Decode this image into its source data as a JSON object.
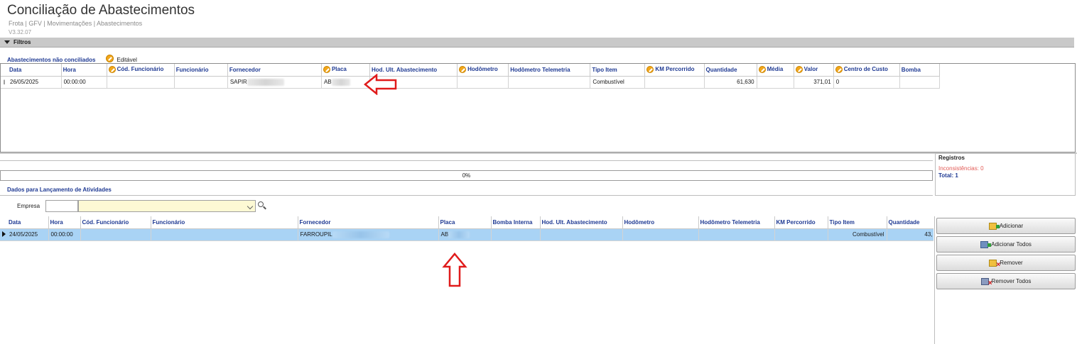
{
  "page": {
    "title": "Conciliação de Abastecimentos",
    "breadcrumb": "Frota | GFV | Movimentações | Abastecimentos",
    "version": "V3.32.07"
  },
  "filters": {
    "label": "Filtros"
  },
  "unconciliated": {
    "title": "Abastecimentos não conciliados",
    "editable_label": "Editável",
    "columns": [
      "Data",
      "Hora",
      "Cód. Funcionário",
      "Funcionário",
      "Fornecedor",
      "Placa",
      "Hod. Ult. Abastecimento",
      "Hodômetro",
      "Hodômetro Telemetria",
      "Tipo Item",
      "KM Percorrido",
      "Quantidade",
      "Média",
      "Valor",
      "Centro de Custo",
      "Bomba"
    ],
    "editable_columns": [
      "Cód. Funcionário",
      "Placa",
      "Hodômetro",
      "KM Percorrido",
      "Média",
      "Valor",
      "Centro de Custo"
    ],
    "row_marker": "I",
    "rows": [
      {
        "data": "26/05/2025",
        "hora": "00:00:00",
        "cod_funcionario": "",
        "funcionario": "",
        "fornecedor": "SAPIR",
        "placa": "AB",
        "hod_ult": "",
        "hodometro": "",
        "hod_tele": "",
        "tipo_item": "Combustível",
        "km": "",
        "quantidade": "61,630",
        "media": "",
        "valor": "371,01",
        "centro_custo": "0",
        "bomba": ""
      }
    ]
  },
  "progress": {
    "text": "0%"
  },
  "registros": {
    "title": "Registros",
    "inconsistencias": "Inconsistências: 0",
    "total": "Total: 1"
  },
  "lancamento": {
    "title": "Dados para Lançamento de Atividades",
    "empresa_label": "Empresa",
    "columns": [
      "Data",
      "Hora",
      "Cód. Funcionário",
      "Funcionário",
      "Fornecedor",
      "Placa",
      "Bomba Interna",
      "Hod. Ult. Abastecimento",
      "Hodômetro",
      "Hodômetro Telemetria",
      "KM Percorrido",
      "Tipo Item",
      "Quantidade"
    ],
    "rows": [
      {
        "data": "24/05/2025",
        "hora": "00:00:00",
        "cod_funcionario": "",
        "funcionario": "",
        "fornecedor": "FARROUPIL",
        "placa": "AB",
        "bomba": "",
        "hod_ult": "",
        "hodometro": "",
        "hod_tele": "",
        "km": "",
        "tipo_item": "Combustível",
        "quantidade": "43,"
      }
    ]
  },
  "actions": {
    "add": "Adicionar",
    "add_all": "Adicionar Todos",
    "remove": "Remover",
    "remove_all": "Remover Todos"
  },
  "colors": {
    "header_text": "#1f3a93",
    "selected_row": "#a9d3f5",
    "annotation_arrow": "#e01b1b",
    "inconsistencias": "#e25a55"
  }
}
